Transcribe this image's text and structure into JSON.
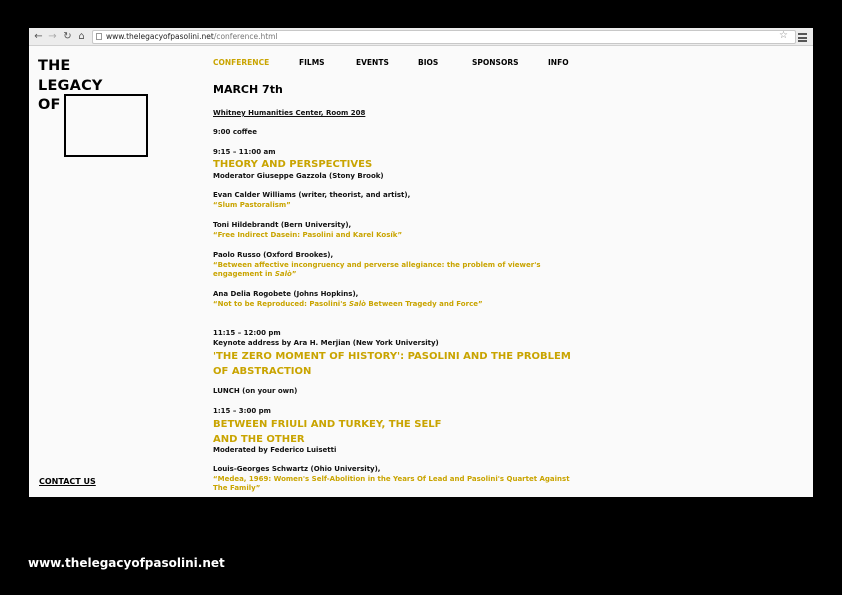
{
  "browser": {
    "url_host": "www.thelegacyofpasolini.net",
    "url_path": "/conference.html",
    "back": "←",
    "forward": "→",
    "reload": "↻",
    "home": "⌂",
    "star": "☆"
  },
  "logo": {
    "line1": "THE",
    "line2": "LEGACY",
    "line3": "OF"
  },
  "nav": [
    "CONFERENCE",
    "FILMS",
    "EVENTS",
    "BIOS",
    "SPONSORS",
    "INFO"
  ],
  "contact_label": "CONTACT US",
  "schedule": {
    "date": "MARCH 7th",
    "venue": "Whitney Humanities Center, Room 208",
    "coffee": "9:00 coffee",
    "s1_time": "9:15 – 11:00 am",
    "s1_title": "THEORY AND PERSPECTIVES",
    "s1_mod": "Moderator Giuseppe Gazzola (Stony Brook)",
    "p1_speaker": "Evan Calder Williams (writer, theorist, and artist),",
    "p1_title": "“Slum Pastoralism”",
    "p2_speaker": "Toni Hildebrandt (Bern University),",
    "p2_title": "“Free Indirect Dasein: Pasolini and Karel Kosík”",
    "p3_speaker": "Paolo Russo (Oxford Brookes),",
    "p3_title_a": "“Between affective incongruency and perverse allegiance: the problem of viewer's",
    "p3_title_b": "engagement in",
    "p3_title_b_em": "Salò",
    "p3_title_b_end": "”",
    "p4_speaker": "Ana Delia Rogobete (Johns Hopkins),",
    "p4_title_a": "“Not to be Reproduced: Pasolini's",
    "p4_title_em": "Salò",
    "p4_title_b": "Between Tragedy and Force”",
    "s2_time": "11:15 – 12:00 pm",
    "s2_keynote": "Keynote address by Ara H. Merjian (New York University)",
    "s2_title_a": "'THE ZERO MOMENT OF HISTORY': PASOLINI AND THE PROBLEM",
    "s2_title_b": "OF ABSTRACTION",
    "lunch": "LUNCH (on your own)",
    "s3_time": "1:15 – 3:00 pm",
    "s3_title_a": "BETWEEN FRIULI AND TURKEY, THE SELF",
    "s3_title_b": "AND THE OTHER",
    "s3_mod": "Moderated by Federico Luisetti",
    "p5_speaker": "Louis-Georges Schwartz (Ohio University),",
    "p5_title_a": "“Medea, 1969: Women's Self-Abolition in the Years Of Lead and Pasolini's Quartet Against",
    "p5_title_b": "The Family”"
  },
  "footer_url": "www.thelegacyofpasolini.net",
  "colors": {
    "accent": "#c9a400",
    "page_bg": "#000000",
    "window_bg": "#fafafa"
  }
}
